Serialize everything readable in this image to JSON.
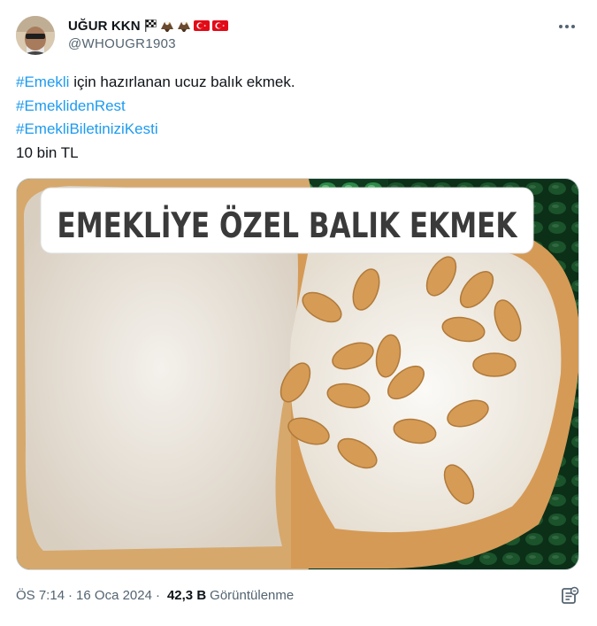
{
  "author": {
    "display_name": "UĞUR KKN",
    "handle": "@WHOUGR1903",
    "name_emojis": [
      "chequered-flag-icon",
      "eagle-icon",
      "eagle-icon",
      "turkey-flag-icon",
      "turkey-flag-icon"
    ]
  },
  "tweet": {
    "text_segments": [
      {
        "hashtag": "#Emekli",
        "text": " için hazırlanan ucuz balık ekmek."
      },
      {
        "hashtag": "#EmeklidenRest",
        "text": ""
      },
      {
        "hashtag": "#EmekliBiletiniziKesti",
        "text": ""
      },
      {
        "hashtag": "",
        "text": "10 bin TL"
      }
    ],
    "image_caption": "EMEKLİYE ÖZEL BALIK EKMEK"
  },
  "meta": {
    "time": "ÖS 7:14",
    "separator": "·",
    "date": "16 Oca 2024",
    "views_count": "42,3 B",
    "views_label": "Görüntülenme"
  },
  "colors": {
    "link": "#1d9bf0",
    "text": "#0f1419",
    "secondary": "#536471"
  }
}
